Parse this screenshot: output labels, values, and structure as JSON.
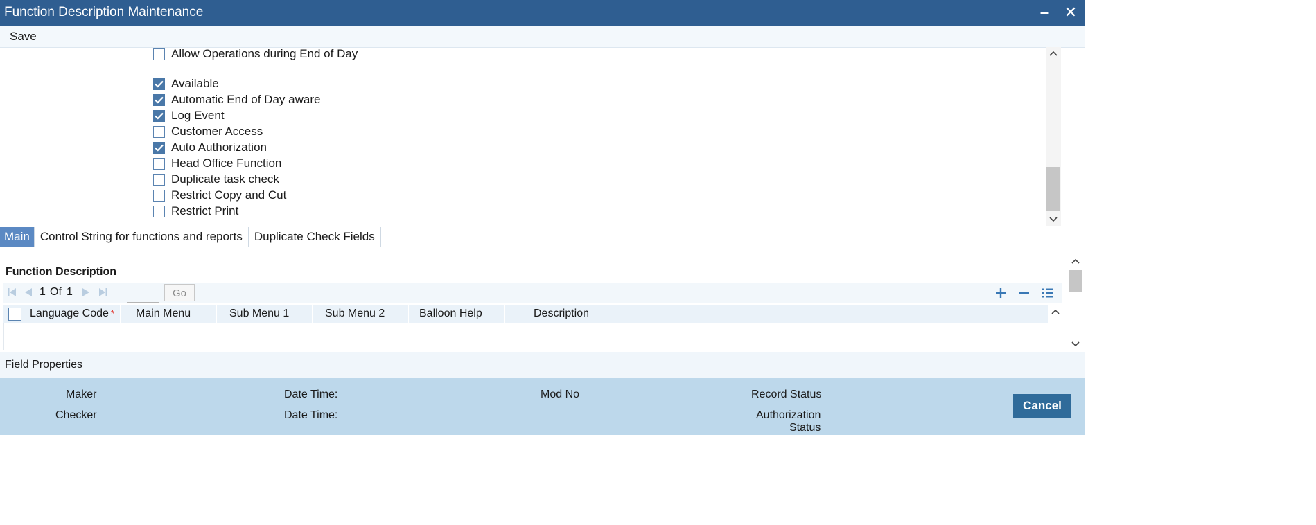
{
  "window": {
    "title": "Function Description Maintenance"
  },
  "toolbar": {
    "save_label": "Save"
  },
  "options": [
    {
      "label": "Allow Operations during End of Day",
      "checked": false
    },
    {
      "label": "Available",
      "checked": true
    },
    {
      "label": "Automatic End of Day aware",
      "checked": true
    },
    {
      "label": "Log Event",
      "checked": true
    },
    {
      "label": "Customer Access",
      "checked": false
    },
    {
      "label": "Auto Authorization",
      "checked": true
    },
    {
      "label": "Head Office Function",
      "checked": false
    },
    {
      "label": "Duplicate task check",
      "checked": false
    },
    {
      "label": "Restrict Copy and Cut",
      "checked": false
    },
    {
      "label": "Restrict Print",
      "checked": false
    }
  ],
  "tabs": [
    {
      "label": "Main",
      "active": true
    },
    {
      "label": "Control String for functions and reports",
      "active": false
    },
    {
      "label": "Duplicate Check Fields",
      "active": false
    }
  ],
  "function_description": {
    "title": "Function Description",
    "pagination": {
      "current": "1",
      "of_label": "Of",
      "total": "1",
      "go_label": "Go"
    },
    "columns": [
      "Language Code",
      "Main Menu",
      "Sub Menu 1",
      "Sub Menu 2",
      "Balloon Help",
      "Description"
    ],
    "required_marker": "*"
  },
  "field_properties": {
    "label": "Field Properties"
  },
  "footer": {
    "maker": "Maker",
    "checker": "Checker",
    "date_time_1": "Date Time:",
    "date_time_2": "Date Time:",
    "mod_no": "Mod No",
    "record_status": "Record Status",
    "authorization_status_line1": "Authorization",
    "authorization_status_line2": "Status",
    "cancel_label": "Cancel"
  },
  "colors": {
    "titlebar": "#2f5e91",
    "checkbox_checked": "#4a78a8",
    "active_tab": "#5b89c3",
    "footer_bg": "#bdd8eb",
    "cancel_button": "#2f6b9a",
    "required": "#e2231a"
  }
}
